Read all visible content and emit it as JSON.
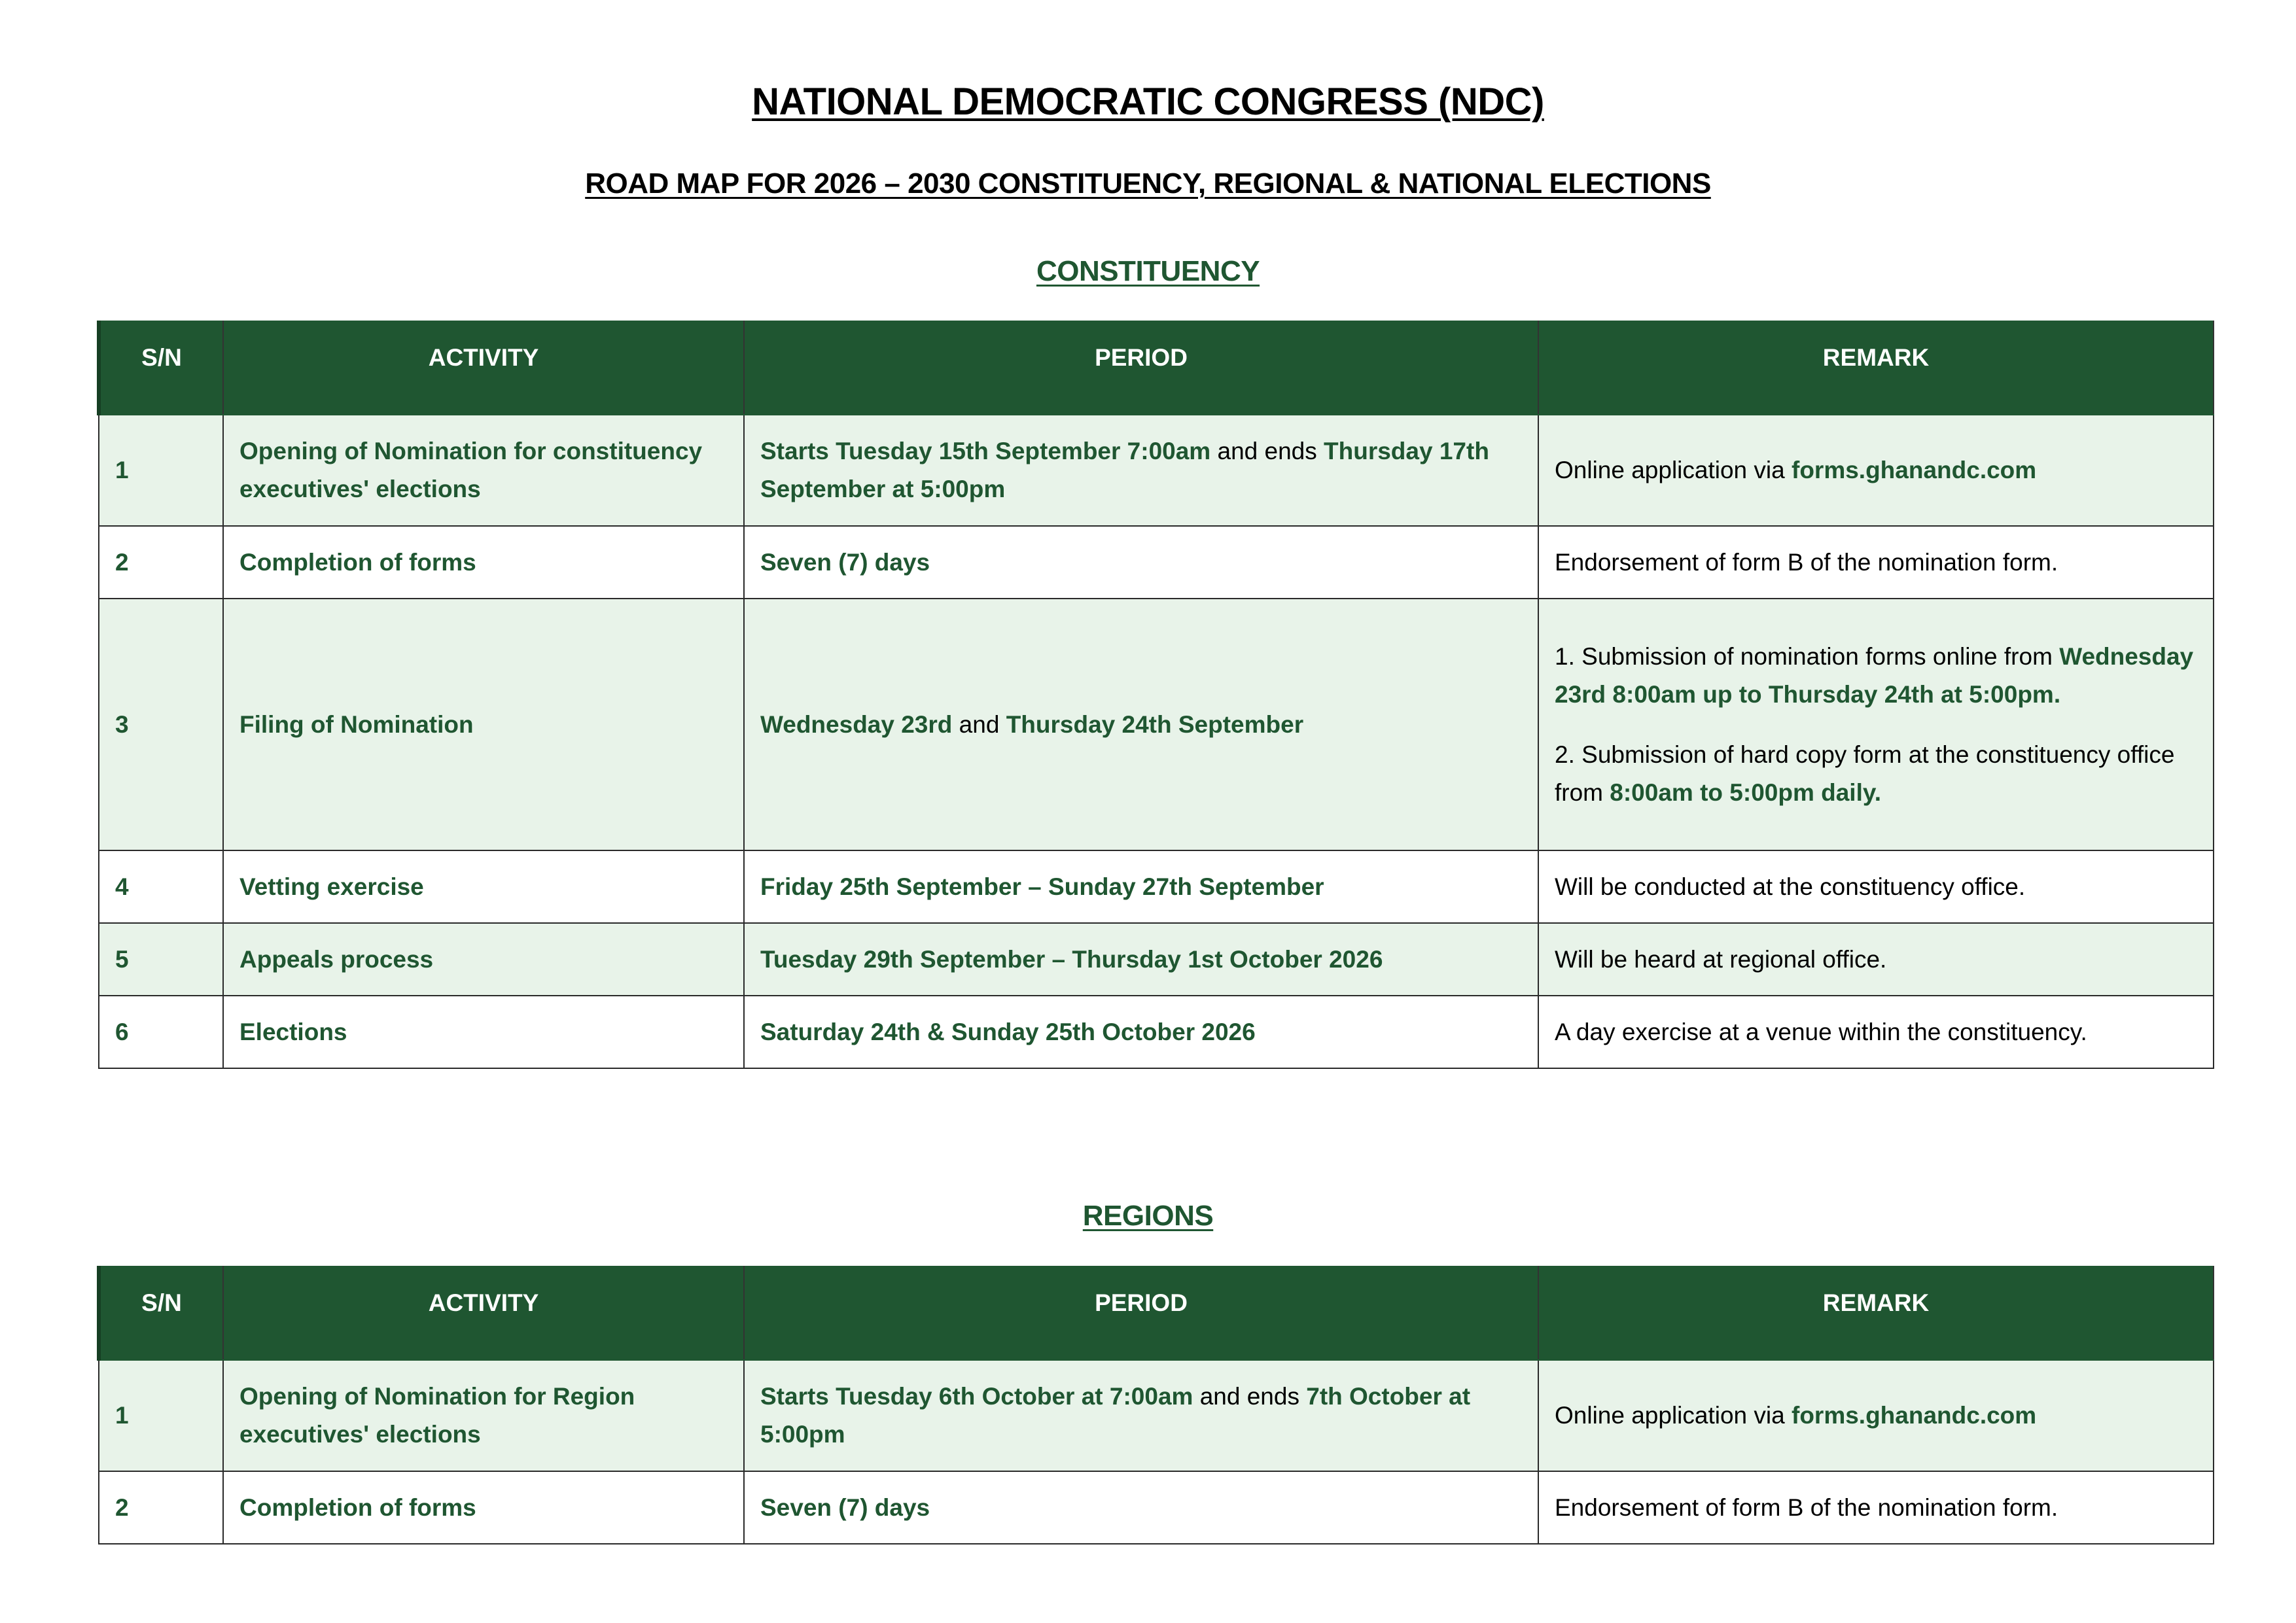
{
  "document": {
    "title": "NATIONAL DEMOCRATIC CONGRESS (NDC)",
    "subtitle": "ROAD MAP FOR 2026 – 2030 CONSTITUENCY, REGIONAL & NATIONAL ELECTIONS"
  },
  "colors": {
    "accent": "#1f5631",
    "row_shade": "#e8f3e9"
  },
  "headers": {
    "sn": "S/N",
    "activity": "ACTIVITY",
    "period": "PERIOD",
    "remark": "REMARK"
  },
  "constituency": {
    "heading": "CONSTITUENCY",
    "rows": [
      {
        "sn": "1",
        "activity": "Opening of Nomination for constituency executives' elections",
        "period": {
          "a": "Starts Tuesday 15th September 7:00am",
          "b": " and ends ",
          "c": "Thursday 17th September at 5:00pm"
        },
        "remark": {
          "a": "Online application via ",
          "b": "forms.ghanandc.com"
        }
      },
      {
        "sn": "2",
        "activity": "Completion of forms",
        "period": {
          "a": "Seven (7) days"
        },
        "remark": {
          "a": "Endorsement of form B of the nomination form."
        }
      },
      {
        "sn": "3",
        "activity": "Filing of Nomination",
        "period": {
          "a": "Wednesday 23rd",
          "b": " and ",
          "c": "Thursday 24th September"
        },
        "remark": {
          "p1a": "1. Submission of nomination forms online from ",
          "p1b": "Wednesday 23rd 8:00am up to Thursday 24th at 5:00pm.",
          "p2a": "2. Submission of hard copy form at the constituency office from ",
          "p2b": "8:00am to 5:00pm daily."
        }
      },
      {
        "sn": "4",
        "activity": "Vetting exercise",
        "period": {
          "a": "Friday 25th September – Sunday 27th September"
        },
        "remark": {
          "a": "Will be conducted at the constituency office."
        }
      },
      {
        "sn": "5",
        "activity": "Appeals process",
        "period": {
          "a": "Tuesday 29th September – Thursday 1st October 2026"
        },
        "remark": {
          "a": "Will be heard at regional office."
        }
      },
      {
        "sn": "6",
        "activity": "Elections",
        "period": {
          "a": "Saturday 24th & Sunday 25th October 2026"
        },
        "remark": {
          "a": "A day exercise at a venue within the constituency."
        }
      }
    ]
  },
  "regions": {
    "heading": "REGIONS",
    "rows": [
      {
        "sn": "1",
        "activity": "Opening of Nomination for Region executives' elections",
        "period": {
          "a": "Starts Tuesday 6th October at 7:00am",
          "b": " and ends ",
          "c": "7th October at 5:00pm"
        },
        "remark": {
          "a": "Online application via ",
          "b": "forms.ghanandc.com"
        }
      },
      {
        "sn": "2",
        "activity": "Completion of forms",
        "period": {
          "a": "Seven (7) days"
        },
        "remark": {
          "a": "Endorsement of form B of the nomination form."
        }
      }
    ]
  }
}
